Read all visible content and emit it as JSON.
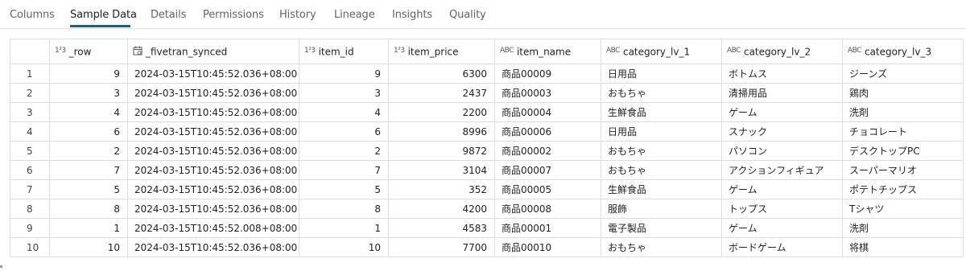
{
  "tabs": [
    {
      "label": "Columns",
      "active": false
    },
    {
      "label": "Sample Data",
      "active": true
    },
    {
      "label": "Details",
      "active": false
    },
    {
      "label": "Permissions",
      "active": false
    },
    {
      "label": "History",
      "active": false
    },
    {
      "label": "Lineage",
      "active": false
    },
    {
      "label": "Insights",
      "active": false
    },
    {
      "label": "Quality",
      "active": false
    }
  ],
  "accent_color": "#1f5f86",
  "columns": [
    {
      "name": "_row",
      "type_icon": "numeric-type-icon",
      "type_glyph": "1²3"
    },
    {
      "name": "_fivetran_synced",
      "type_icon": "calendar-type-icon",
      "type_glyph": ""
    },
    {
      "name": "item_id",
      "type_icon": "numeric-type-icon",
      "type_glyph": "1²3"
    },
    {
      "name": "item_price",
      "type_icon": "numeric-type-icon",
      "type_glyph": "1²3"
    },
    {
      "name": "item_name",
      "type_icon": "string-type-icon",
      "type_glyph": "ABC"
    },
    {
      "name": "category_lv_1",
      "type_icon": "string-type-icon",
      "type_glyph": "ABC"
    },
    {
      "name": "category_lv_2",
      "type_icon": "string-type-icon",
      "type_glyph": "ABC"
    },
    {
      "name": "category_lv_3",
      "type_icon": "string-type-icon",
      "type_glyph": "ABC"
    }
  ],
  "rows": [
    {
      "n": "1",
      "_row": "9",
      "synced": "2024-03-15T10:45:52.036+08:00",
      "item_id": "9",
      "item_price": "6300",
      "item_name": "商品00009",
      "c1": "日用品",
      "c2": "ボトムス",
      "c3": "ジーンズ"
    },
    {
      "n": "2",
      "_row": "3",
      "synced": "2024-03-15T10:45:52.036+08:00",
      "item_id": "3",
      "item_price": "2437",
      "item_name": "商品00003",
      "c1": "おもちゃ",
      "c2": "清掃用品",
      "c3": "鶏肉"
    },
    {
      "n": "3",
      "_row": "4",
      "synced": "2024-03-15T10:45:52.036+08:00",
      "item_id": "4",
      "item_price": "2200",
      "item_name": "商品00004",
      "c1": "生鮮食品",
      "c2": "ゲーム",
      "c3": "洗剤"
    },
    {
      "n": "4",
      "_row": "6",
      "synced": "2024-03-15T10:45:52.036+08:00",
      "item_id": "6",
      "item_price": "8996",
      "item_name": "商品00006",
      "c1": "日用品",
      "c2": "スナック",
      "c3": "チョコレート"
    },
    {
      "n": "5",
      "_row": "2",
      "synced": "2024-03-15T10:45:52.036+08:00",
      "item_id": "2",
      "item_price": "9872",
      "item_name": "商品00002",
      "c1": "おもちゃ",
      "c2": "パソコン",
      "c3": "デスクトップPC"
    },
    {
      "n": "6",
      "_row": "7",
      "synced": "2024-03-15T10:45:52.036+08:00",
      "item_id": "7",
      "item_price": "3104",
      "item_name": "商品00007",
      "c1": "おもちゃ",
      "c2": "アクションフィギュア",
      "c3": "スーパーマリオ"
    },
    {
      "n": "7",
      "_row": "5",
      "synced": "2024-03-15T10:45:52.036+08:00",
      "item_id": "5",
      "item_price": "352",
      "item_name": "商品00005",
      "c1": "生鮮食品",
      "c2": "ゲーム",
      "c3": "ポテトチップス"
    },
    {
      "n": "8",
      "_row": "8",
      "synced": "2024-03-15T10:45:52.036+08:00",
      "item_id": "8",
      "item_price": "4200",
      "item_name": "商品00008",
      "c1": "服飾",
      "c2": "トップス",
      "c3": "Tシャツ"
    },
    {
      "n": "9",
      "_row": "1",
      "synced": "2024-03-15T10:45:52.008+08:00",
      "item_id": "1",
      "item_price": "4583",
      "item_name": "商品00001",
      "c1": "電子製品",
      "c2": "ゲーム",
      "c3": "洗剤"
    },
    {
      "n": "10",
      "_row": "10",
      "synced": "2024-03-15T10:45:52.036+08:00",
      "item_id": "10",
      "item_price": "7700",
      "item_name": "商品00010",
      "c1": "おもちゃ",
      "c2": "ボードゲーム",
      "c3": "将棋"
    }
  ]
}
